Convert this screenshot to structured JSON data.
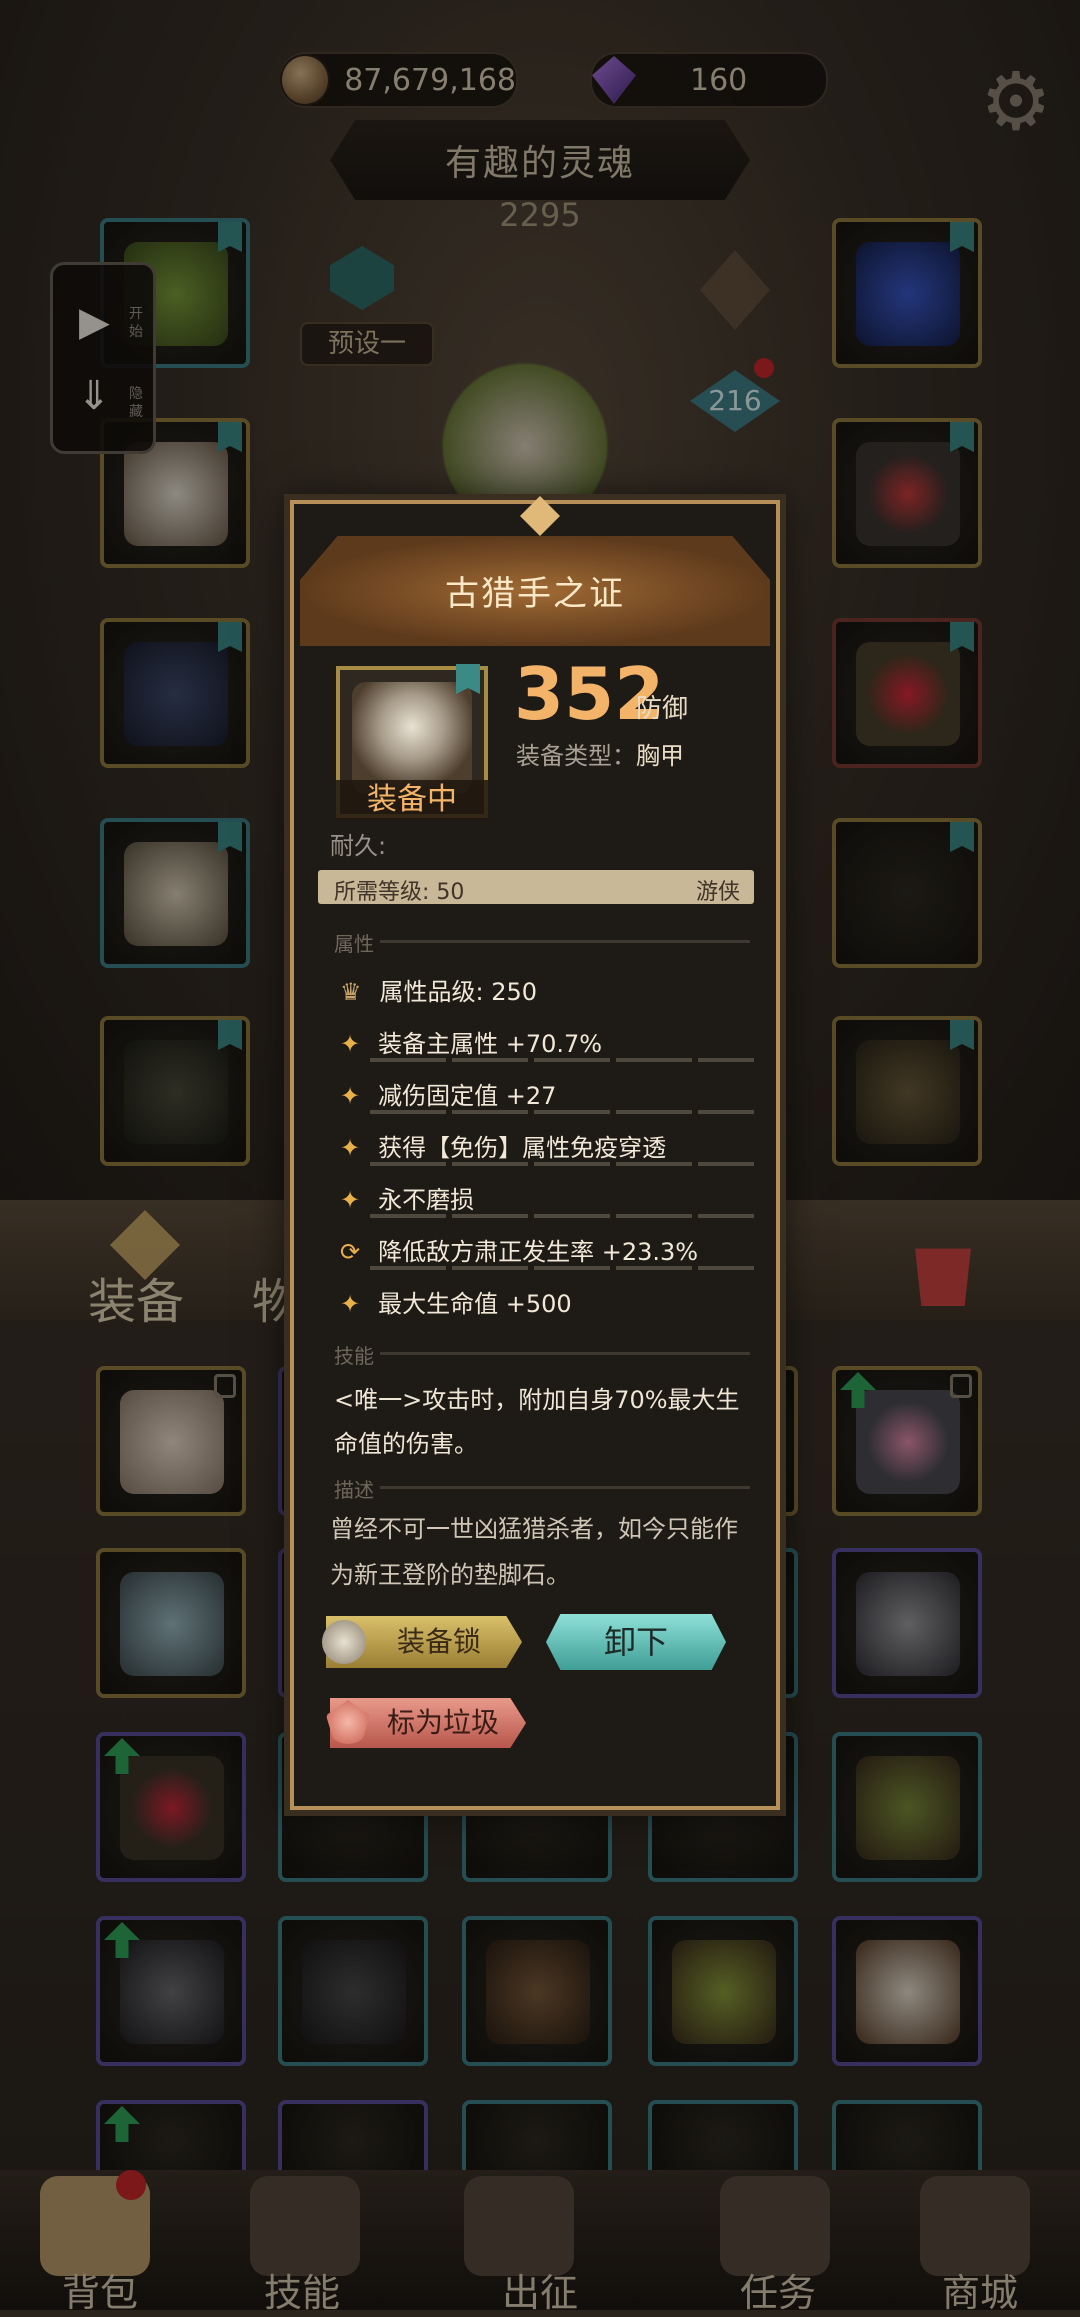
{
  "currency": {
    "gold": "87,679,168",
    "gems": "160"
  },
  "character": {
    "name": "有趣的灵魂",
    "power": "2295",
    "preset": "预设一",
    "level": "216"
  },
  "side_widget": {
    "start_label": "开始",
    "hide_label": "隐藏"
  },
  "inventory_tabs": {
    "equipment": "装备",
    "items": "物品"
  },
  "bottom_nav": [
    {
      "label": "背包"
    },
    {
      "label": "技能"
    },
    {
      "label": "出征"
    },
    {
      "label": "任务"
    },
    {
      "label": "商城"
    }
  ],
  "item_detail": {
    "name": "古猎手之证",
    "equipped_label": "装备中",
    "defense_value": "352",
    "defense_label": "防御",
    "type_label": "装备类型：",
    "type_value": "胸甲",
    "durability_label": "耐久:",
    "required_level": "所需等级: 50",
    "required_class": "游侠",
    "section_attributes": "属性",
    "attribute_grade": "属性品级: 250",
    "attributes": [
      "装备主属性 +70.7%",
      "减伤固定值 +27",
      "获得【免伤】属性免疫穿透",
      "永不磨损",
      "降低敌方肃正发生率 +23.3%",
      "最大生命值 +500"
    ],
    "section_skill": "技能",
    "skill_text": "<唯一>攻击时，附加自身70%最大生命值的伤害。",
    "section_description": "描述",
    "description": "曾经不可一世凶猛猎杀者，如今只能作为新王登阶的垫脚石。",
    "buttons": {
      "lock": "装备锁",
      "unequip": "卸下",
      "junk": "标为垃圾"
    }
  },
  "colors": {
    "gold_text": "#f3b46a",
    "panel_border": "#b69058",
    "teal_button": "#3f9e96",
    "junk_button": "#b8564c"
  }
}
